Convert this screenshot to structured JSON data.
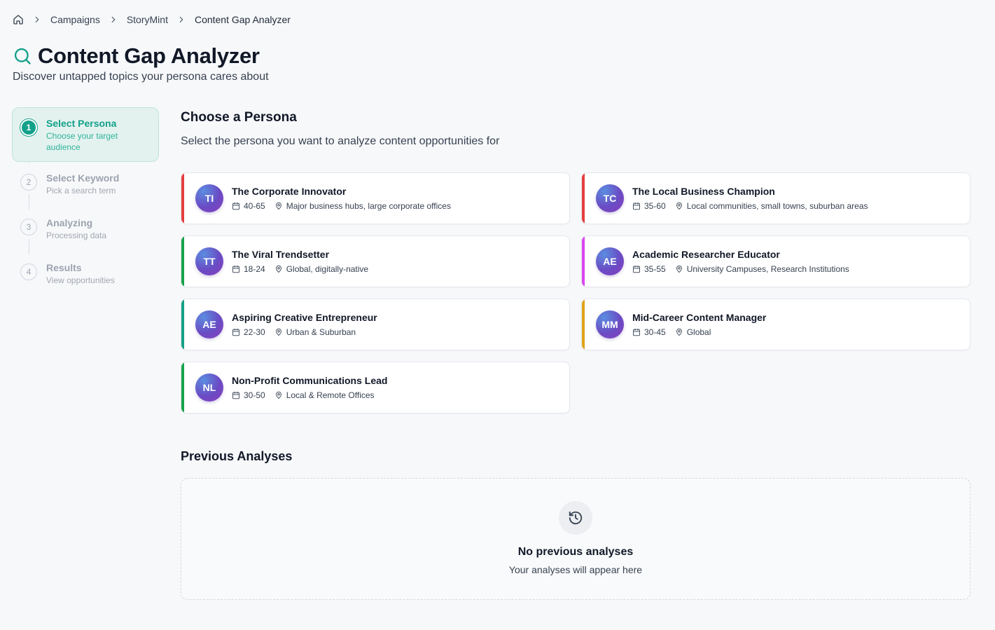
{
  "breadcrumb": {
    "items": [
      "Campaigns",
      "StoryMint",
      "Content Gap Analyzer"
    ]
  },
  "header": {
    "title": "Content Gap Analyzer",
    "subtitle": "Discover untapped topics your persona cares about",
    "accent_color": "#13a08a"
  },
  "steps": [
    {
      "number": "1",
      "label": "Select Persona",
      "desc": "Choose your target audience",
      "state": "active"
    },
    {
      "number": "2",
      "label": "Select Keyword",
      "desc": "Pick a search term",
      "state": "pending"
    },
    {
      "number": "3",
      "label": "Analyzing",
      "desc": "Processing data",
      "state": "pending"
    },
    {
      "number": "4",
      "label": "Results",
      "desc": "View opportunities",
      "state": "pending"
    }
  ],
  "main": {
    "section_title": "Choose a Persona",
    "section_subtitle": "Select the persona you want to analyze content opportunities for"
  },
  "personas": [
    {
      "initials": "TI",
      "name": "The Corporate Innovator",
      "age": "40-65",
      "location": "Major business hubs, large corporate offices",
      "accent": "#e53e3e"
    },
    {
      "initials": "TC",
      "name": "The Local Business Champion",
      "age": "35-60",
      "location": "Local communities, small towns, suburban areas",
      "accent": "#e53e3e"
    },
    {
      "initials": "TT",
      "name": "The Viral Trendsetter",
      "age": "18-24",
      "location": "Global, digitally-native",
      "accent": "#16a34a"
    },
    {
      "initials": "AE",
      "name": "Academic Researcher Educator",
      "age": "35-55",
      "location": "University Campuses, Research Institutions",
      "accent": "#d946ef"
    },
    {
      "initials": "AE",
      "name": "Aspiring Creative Entrepreneur",
      "age": "22-30",
      "location": "Urban & Suburban",
      "accent": "#14a085"
    },
    {
      "initials": "MM",
      "name": "Mid-Career Content Manager",
      "age": "30-45",
      "location": "Global",
      "accent": "#e0a418"
    },
    {
      "initials": "NL",
      "name": "Non-Profit Communications Lead",
      "age": "30-50",
      "location": "Local & Remote Offices",
      "accent": "#16a34a"
    }
  ],
  "previous": {
    "title": "Previous Analyses",
    "empty_title": "No previous analyses",
    "empty_desc": "Your analyses will appear here",
    "icon": "history-icon"
  }
}
